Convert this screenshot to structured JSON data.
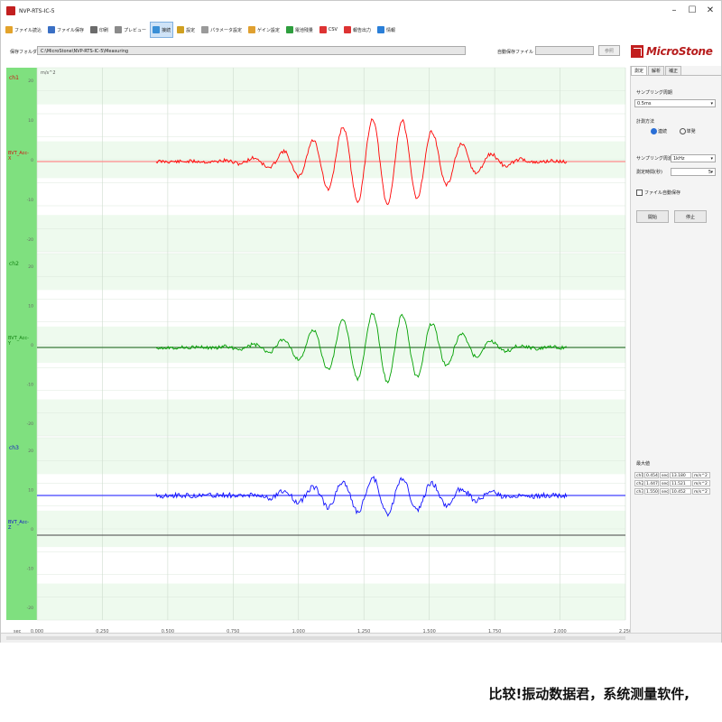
{
  "window": {
    "title": "NVP-RTS-IC-5"
  },
  "toolbar": {
    "items": [
      {
        "label": "ファイル読込",
        "color": "#e3a32b"
      },
      {
        "label": "ファイル保存",
        "color": "#3a6fc4"
      },
      {
        "label": "印刷",
        "color": "#6b6b6b"
      },
      {
        "label": "プレビュー",
        "color": "#8a8a8a"
      },
      {
        "label": "接続",
        "color": "#3a8fd6",
        "active": true
      },
      {
        "label": "設定",
        "color": "#d0a020"
      },
      {
        "label": "パラメータ設定",
        "color": "#9a9a9a"
      },
      {
        "label": "ゲイン設定",
        "color": "#e0a030"
      },
      {
        "label": "電池残量",
        "color": "#2e9e3e"
      },
      {
        "label": "CSV",
        "color": "#d33"
      },
      {
        "label": "報告出力",
        "color": "#d33"
      },
      {
        "label": "情報",
        "color": "#2a7fd8"
      }
    ]
  },
  "path": {
    "label": "保存フォルダ",
    "value": "C:\\MicroStone\\NVP-RTS-IC-5\\Measuring",
    "history_label": "自動保存ファイル",
    "history_button": "参照"
  },
  "logo": {
    "text": "MicroStone"
  },
  "plot": {
    "unit_label": "m/s^2",
    "x_ticks": [
      "0.000",
      "0.250",
      "0.500",
      "0.750",
      "1.000",
      "1.250",
      "1.500",
      "1.750",
      "2.000",
      "2.250"
    ],
    "channels": [
      {
        "name": "ch1",
        "color": "#ff0000",
        "text_color": "#d01010",
        "sensor": "BVT_Acc-\nX",
        "y_ticks": [
          "20",
          "10",
          "0",
          "-10",
          "-20"
        ]
      },
      {
        "name": "ch2",
        "color": "#00a000",
        "text_color": "#108010",
        "sensor": "BVT_Acc-\nY",
        "y_ticks": [
          "20",
          "10",
          "0",
          "-10",
          "-20"
        ]
      },
      {
        "name": "ch3",
        "color": "#1010ff",
        "text_color": "#1010c8",
        "sensor": "BVT_Acc-\nZ",
        "y_ticks": [
          "20",
          "10",
          "0",
          "-10",
          "-20"
        ]
      }
    ]
  },
  "panel": {
    "tabs": [
      "測定",
      "解析",
      "補正"
    ],
    "sampling_label": "サンプリング周期",
    "sampling_value": "0.5ms",
    "mode_label": "計測方法",
    "mode_options": [
      "連続",
      "単発"
    ],
    "mode_selected": 0,
    "rate_label": "サンプリング周波数",
    "rate_value": "1kHz",
    "time_label": "測定時間(秒)",
    "time_value": "5",
    "autosave_label": "ファイル自動保存",
    "start_button": "開始",
    "stop_button": "停止",
    "readout_title": "最大値",
    "readout": [
      {
        "ch": "ch1",
        "t": "0.454",
        "tu": "sec",
        "v": "13.180",
        "vu": "m/s^2"
      },
      {
        "ch": "ch2",
        "t": "1.447",
        "tu": "sec",
        "v": "11.521",
        "vu": "m/s^2"
      },
      {
        "ch": "ch3",
        "t": "1.550",
        "tu": "sec",
        "v": "10.452",
        "vu": "m/s^2"
      }
    ]
  },
  "caption": {
    "text": "比较!振动数据君，系统测量软件,"
  }
}
